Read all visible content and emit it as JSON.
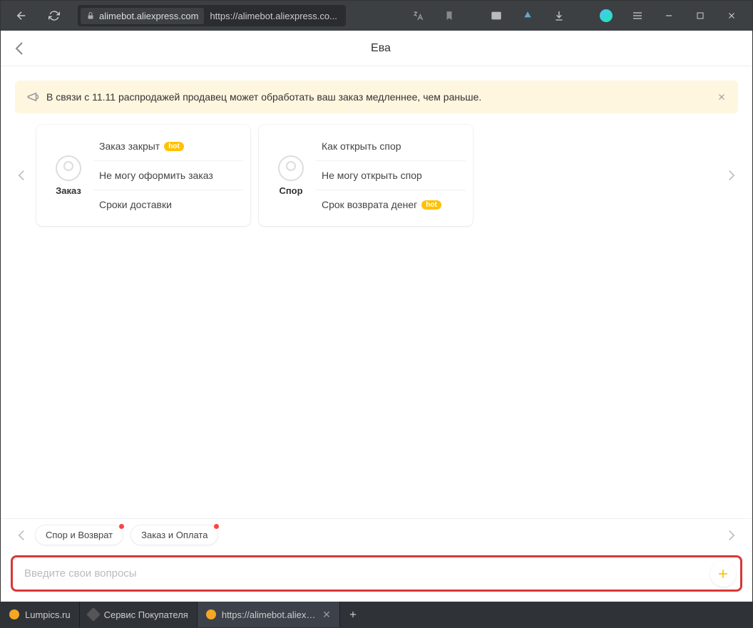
{
  "browser": {
    "domain": "alimebot.aliexpress.com",
    "url_truncated": "https://alimebot.aliexpress.co..."
  },
  "page": {
    "title": "Ева"
  },
  "notice": {
    "text": "В связи с 11.11 распродажей продавец может обработать ваш заказ медленнее, чем раньше."
  },
  "cards": [
    {
      "label": "Заказ",
      "items": [
        {
          "text": "Заказ закрыт",
          "hot": true
        },
        {
          "text": "Не могу оформить заказ",
          "hot": false
        },
        {
          "text": "Сроки доставки",
          "hot": false
        }
      ]
    },
    {
      "label": "Спор",
      "items": [
        {
          "text": "Как открыть спор",
          "hot": false
        },
        {
          "text": "Не могу открыть спор",
          "hot": false
        },
        {
          "text": "Срок возврата денег",
          "hot": true
        }
      ]
    }
  ],
  "chips": [
    {
      "text": "Спор и Возврат"
    },
    {
      "text": "Заказ и Оплата"
    }
  ],
  "input": {
    "placeholder": "Введите свои вопросы"
  },
  "hot_label": "hot",
  "tabs": [
    {
      "text": "Lumpics.ru",
      "favicon": "#f5a623",
      "active": false
    },
    {
      "text": "Сервис Покупателя",
      "favicon": "#888",
      "active": false
    },
    {
      "text": "https://alimebot.aliexpre",
      "favicon": "#f5a623",
      "active": true
    }
  ]
}
